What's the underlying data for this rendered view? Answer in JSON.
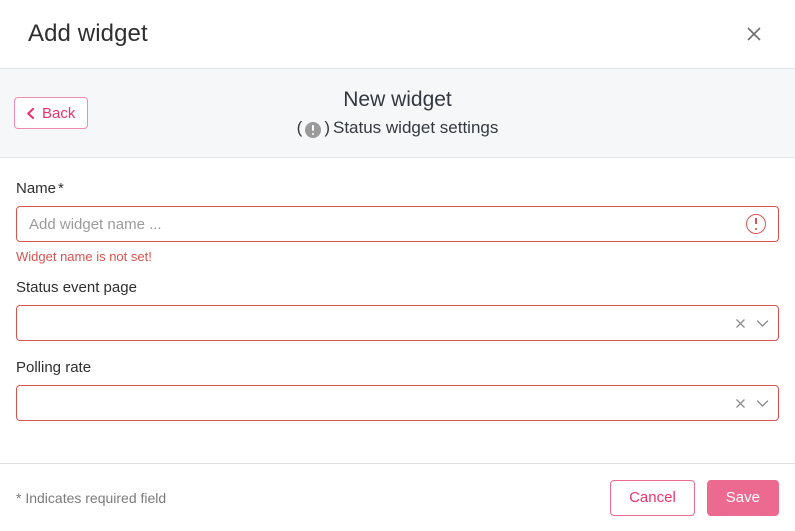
{
  "dialog": {
    "title": "Add widget",
    "close_icon": "close-icon"
  },
  "subheader": {
    "title": "New widget",
    "paren_open": "(",
    "paren_close": ")",
    "status_icon": "status-alert-icon",
    "subtitle": "Status widget settings",
    "back_label": "Back",
    "back_icon": "chevron-left-icon"
  },
  "form": {
    "name": {
      "label": "Name",
      "required_mark": "*",
      "value": "",
      "placeholder": "Add widget name ...",
      "error": "Widget name is not set!",
      "error_icon": "alert-circle-icon"
    },
    "status_event_page": {
      "label": "Status event page",
      "value": "",
      "clear_icon": "clear-icon",
      "caret_icon": "chevron-down-icon"
    },
    "polling_rate": {
      "label": "Polling rate",
      "value": "",
      "clear_icon": "clear-icon",
      "caret_icon": "chevron-down-icon"
    }
  },
  "footer": {
    "required_note": "* Indicates required field",
    "cancel_label": "Cancel",
    "save_label": "Save"
  },
  "colors": {
    "accent_pink": "#ec6a90",
    "accent_pink_text": "#e8336d",
    "error_red": "#d9534f",
    "header_band": "#f6f7f8",
    "border_gray": "#e1e3e6"
  }
}
